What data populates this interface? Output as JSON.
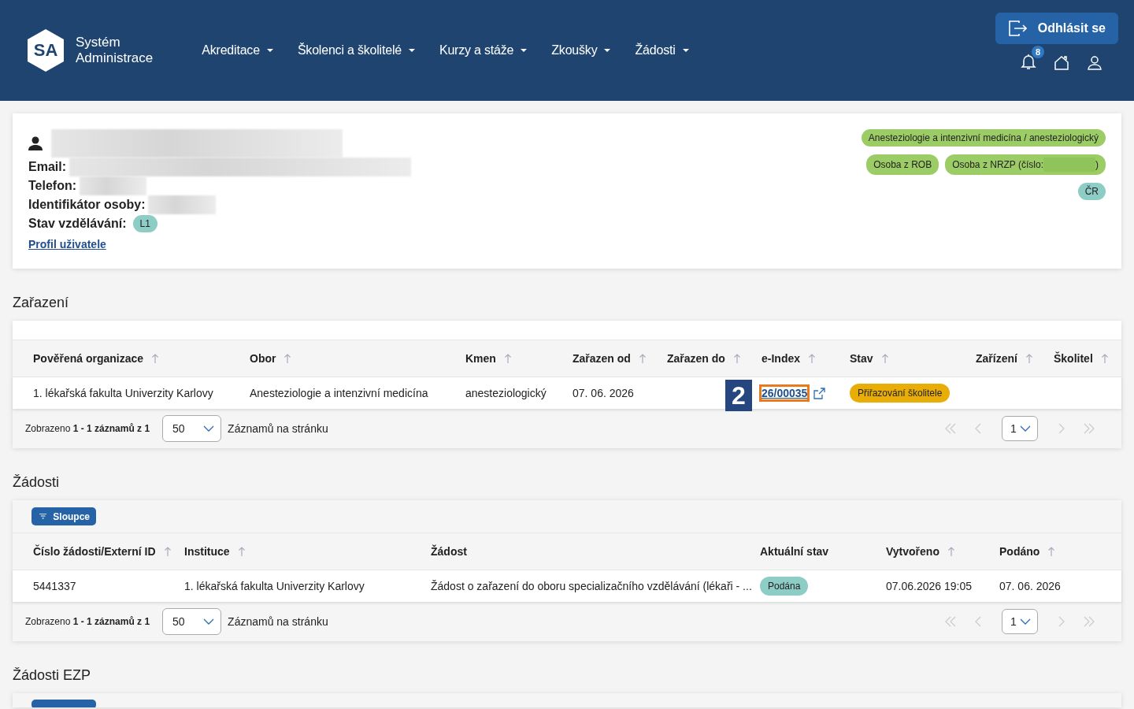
{
  "header": {
    "logo_mark": "SA",
    "logo_text": [
      "Systém",
      "Administrace"
    ],
    "nav": [
      {
        "label": "Akreditace"
      },
      {
        "label": "Školenci a školitelé"
      },
      {
        "label": "Kurzy a stáže"
      },
      {
        "label": "Zkoušky"
      },
      {
        "label": "Žádosti"
      }
    ],
    "logout": "Odhlásit se",
    "notifications": "8"
  },
  "profile": {
    "name_redacted": true,
    "fields": [
      {
        "label": "Email:",
        "redacted": true,
        "kind": "text"
      },
      {
        "label": "Telefon:",
        "redacted": true,
        "kind": "text"
      },
      {
        "label": "Identifikátor osoby:",
        "redacted": true,
        "kind": "text"
      },
      {
        "label": "Stav vzdělávání:",
        "kind": "badge",
        "value": "L1",
        "color": "#8ecdc6"
      }
    ],
    "link": "Profil uživatele",
    "tags": [
      [
        {
          "text": "Anesteziologie a intenzivní medicína / anesteziologický",
          "color": "#9ccc65"
        }
      ],
      [
        {
          "text": "Osoba z ROB",
          "color": "#9ccc65"
        },
        {
          "text": "Osoba z NRZP (číslo:",
          "suffix": ")",
          "redacted": true,
          "color": "#9ccc65"
        }
      ],
      [
        {
          "text": "ČR",
          "color": "#8ecdc6"
        }
      ]
    ]
  },
  "sections": [
    {
      "title": "Zařazení",
      "columns_button": false,
      "columns": [
        {
          "label": "Pověřená organizace",
          "sortable": true
        },
        {
          "label": "Obor",
          "sortable": true
        },
        {
          "label": "Kmen",
          "sortable": true
        },
        {
          "label": "Zařazen od",
          "sortable": true
        },
        {
          "label": "Zařazen do",
          "sortable": true
        },
        {
          "label": "e-Index",
          "sortable": true
        },
        {
          "label": "Stav",
          "sortable": true
        },
        {
          "label": "Zařízení",
          "sortable": true
        },
        {
          "label": "Školitel",
          "sortable": true
        }
      ],
      "rows": [
        [
          {
            "kind": "text",
            "text": "1. lékařská fakulta Univerzity Karlovy"
          },
          {
            "kind": "text",
            "text": "Anesteziologie a intenzivní medicína"
          },
          {
            "kind": "text",
            "text": "anesteziologický"
          },
          {
            "kind": "text",
            "text": "07. 06. 2026"
          },
          {
            "kind": "empty"
          },
          {
            "kind": "link",
            "text": "26/00035",
            "highlighted": true,
            "annotation": "2"
          },
          {
            "kind": "badge",
            "text": "Přiřazování školitele",
            "color": "#e8ad07"
          },
          {
            "kind": "empty"
          },
          {
            "kind": "empty"
          }
        ]
      ],
      "pager": {
        "summary": "Zobrazeno **1 - 1 záznamů z 1**",
        "page_size": "50",
        "page_size_label": "Záznamů na stránku",
        "page": "1"
      }
    },
    {
      "title": "Žádosti",
      "columns_button": "Sloupce",
      "columns": [
        {
          "label": "Číslo žádosti/Externí ID",
          "sortable": true
        },
        {
          "label": "Instituce",
          "sortable": true
        },
        {
          "label": "Žádost",
          "sortable": false
        },
        {
          "label": "Aktuální stav",
          "sortable": false
        },
        {
          "label": "Vytvořeno",
          "sortable": true
        },
        {
          "label": "Podáno",
          "sortable": true
        }
      ],
      "rows": [
        [
          {
            "kind": "text",
            "text": "5441337"
          },
          {
            "kind": "text",
            "text": "1. lékařská fakulta Univerzity Karlovy"
          },
          {
            "kind": "text",
            "text": "Žádost o zařazení do oboru specializačního vzdělávání (lékaři - ..."
          },
          {
            "kind": "badge",
            "text": "Podána",
            "color": "#8ecdc6"
          },
          {
            "kind": "text",
            "text": "07.06.2026 19:05"
          },
          {
            "kind": "text",
            "text": "07. 06. 2026"
          }
        ]
      ],
      "pager": {
        "summary": "Zobrazeno **1 - 1 záznamů z 1**",
        "page_size": "50",
        "page_size_label": "Záznamů na stránku",
        "page": "1"
      }
    },
    {
      "title": "Žádosti EZP",
      "columns_button": true,
      "cut": true
    }
  ]
}
